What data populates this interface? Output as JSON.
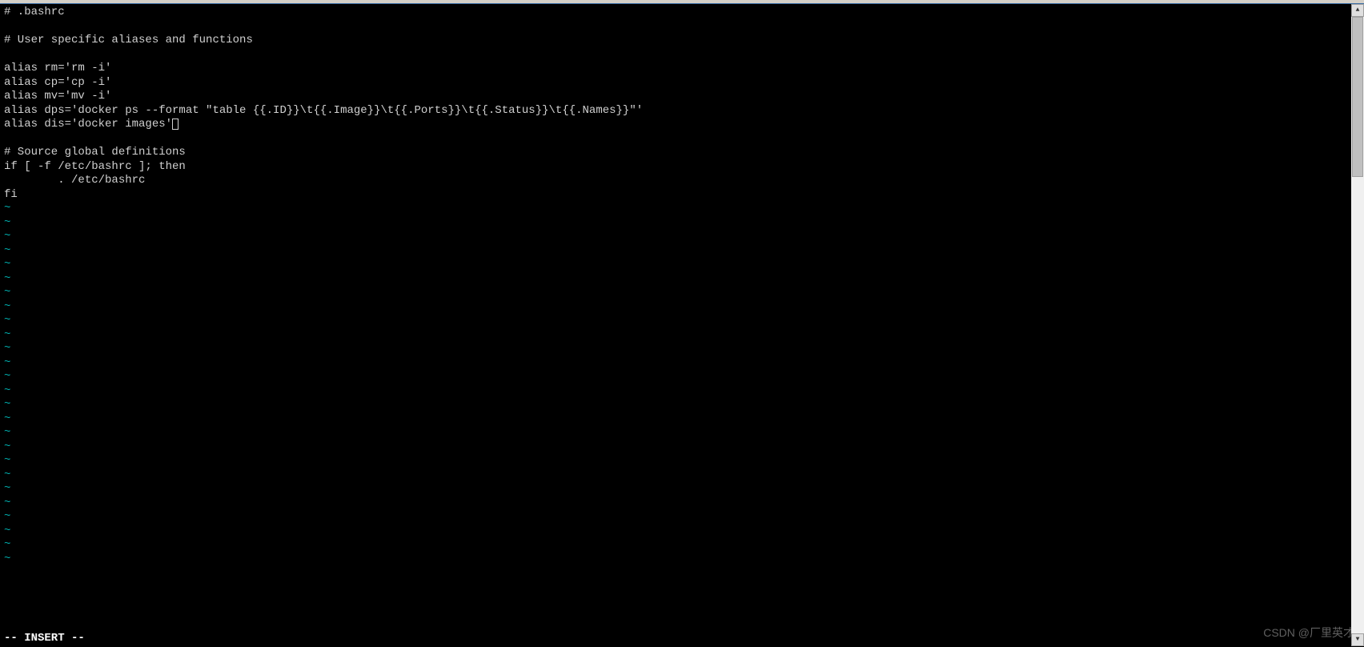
{
  "editor": {
    "lines": [
      "# .bashrc",
      "",
      "# User specific aliases and functions",
      "",
      "alias rm='rm -i'",
      "alias cp='cp -i'",
      "alias mv='mv -i'",
      "alias dps='docker ps --format \"table {{.ID}}\\t{{.Image}}\\t{{.Ports}}\\t{{.Status}}\\t{{.Names}}\"'",
      "alias dis='docker images'",
      "",
      "# Source global definitions",
      "if [ -f /etc/bashrc ]; then",
      "        . /etc/bashrc",
      "fi"
    ],
    "tilde_char": "~",
    "tilde_count": 26,
    "cursor_line_index": 8
  },
  "status": {
    "mode": "-- INSERT --"
  },
  "watermark": {
    "text": "CSDN @厂里英才"
  },
  "scrollbar": {
    "up_glyph": "▲",
    "down_glyph": "▼"
  }
}
